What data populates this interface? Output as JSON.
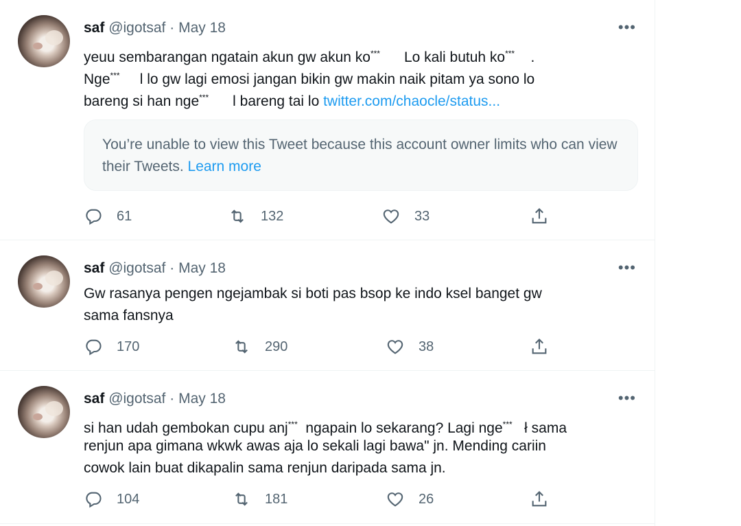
{
  "tweets": [
    {
      "name": "saf",
      "handle": "@igotsaf",
      "sep": "·",
      "date": "May 18",
      "more": "•••",
      "lines": [
        {
          "a": "yeuu sembarangan ngatain akun gw akun ko",
          "b": "***",
          "c": "      Lo kali butuh ko",
          "d": "***",
          "e": "    ."
        },
        {
          "a": "Nge",
          "b": "***",
          "c": "     l lo gw lagi emosi jangan bikin gw makin naik pitam ya sono lo"
        },
        {
          "a": "bareng si han nge",
          "b": "***",
          "c": "      l bareng tai lo ",
          "link": "twitter.com/chaocle/status..."
        }
      ],
      "quote": {
        "text": "You’re unable to view this Tweet because this account owner limits who can view their Tweets.",
        "learn_more": "Learn more"
      },
      "replies": "61",
      "retweets": "132",
      "likes": "33"
    },
    {
      "name": "saf",
      "handle": "@igotsaf",
      "sep": "·",
      "date": "May 18",
      "more": "•••",
      "lines": [
        {
          "a": "Gw rasanya pengen ngejambak si boti pas bsop ke indo ksel banget gw"
        },
        {
          "a": "sama fansnya"
        }
      ],
      "replies": "170",
      "retweets": "290",
      "likes": "38"
    },
    {
      "name": "saf",
      "handle": "@igotsaf",
      "sep": "·",
      "date": "May 18",
      "more": "•••",
      "lines": [
        {
          "a": "si han udah gembokan cupu anj",
          "b": "***",
          "c": "  ngapain lo sekarang? Lagi nge",
          "d": "***",
          "e": "   ł sama"
        },
        {
          "a": "renjun apa gimana wkwk awas aja lo sekali lagi bawa\" jn. Mending cariin"
        },
        {
          "a": "cowok lain buat dikapalin sama renjun daripada sama jn."
        }
      ],
      "replies": "104",
      "retweets": "181",
      "likes": "26"
    }
  ],
  "icons": {
    "reply": "reply-icon",
    "retweet": "retweet-icon",
    "like": "heart-icon",
    "share": "share-icon",
    "more": "more-icon"
  },
  "colors": {
    "link": "#1d9bf0",
    "secondary": "#536471",
    "text": "#0f1419"
  }
}
